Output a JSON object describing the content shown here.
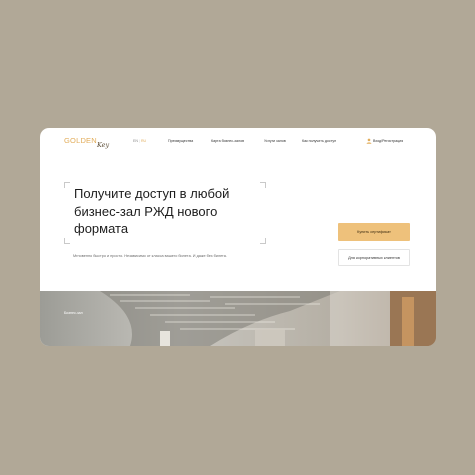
{
  "brand": {
    "logo_text": "GOLDEN",
    "logo_script": "Key"
  },
  "language": {
    "options": [
      "EN",
      "RU"
    ],
    "active": "RU"
  },
  "nav": {
    "items": [
      {
        "label": "Преимущества"
      },
      {
        "label": "Карта бизнес-залов"
      },
      {
        "label": "Услуги залов"
      },
      {
        "label": "Как получить доступ"
      }
    ],
    "login_label": "Вход/Регистрация"
  },
  "hero": {
    "title": "Получите доступ в любой бизнес-зал РЖД нового формата",
    "subtitle": "Мгновенно быстро и просто. Независимо от класса вашего билета. И даже без билета.",
    "image_label": "Бизнес-зал"
  },
  "actions": {
    "buy_label": "Купить сертификат",
    "corporate_label": "Для корпоративных клиентов"
  },
  "colors": {
    "background": "#b1a897",
    "accent": "#e2ad5b",
    "button": "#eec17b"
  }
}
